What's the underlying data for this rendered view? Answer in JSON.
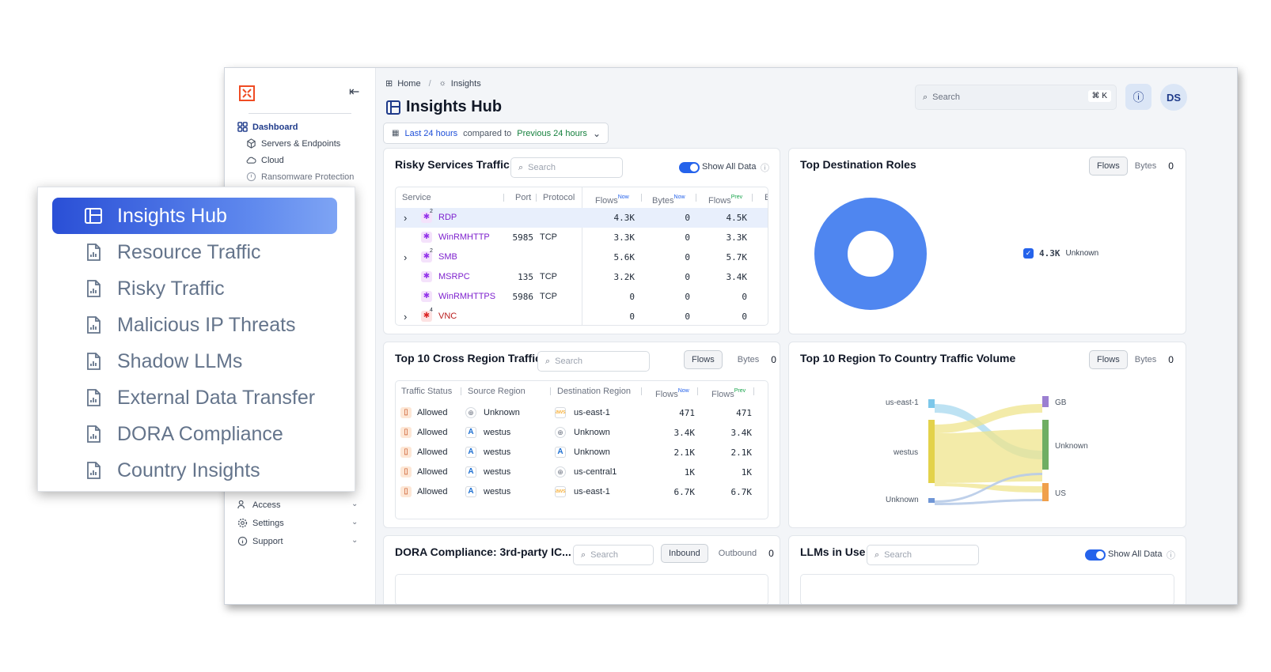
{
  "sidebar": {
    "dashboard": "Dashboard",
    "items": [
      "Servers & Endpoints",
      "Cloud",
      "Ransomware Protection"
    ],
    "bottom": [
      "Access",
      "Settings",
      "Support"
    ]
  },
  "popup": {
    "active": "Insights Hub",
    "items": [
      "Resource Traffic",
      "Risky Traffic",
      "Malicious IP Threats",
      "Shadow LLMs",
      "External Data Transfer",
      "DORA Compliance",
      "Country Insights"
    ]
  },
  "header": {
    "breadcrumb_home": "Home",
    "breadcrumb_sep": "/",
    "breadcrumb_current": "Insights",
    "title": "Insights Hub",
    "range_now": "Last 24 hours",
    "range_text": "compared to",
    "range_prev": "Previous 24 hours",
    "search_placeholder": "Search",
    "shortcut": "⌘ K",
    "avatar": "DS"
  },
  "risky": {
    "title": "Risky Services Traffic",
    "search": "Search",
    "toggle_label": "Show All Data",
    "cols": {
      "service": "Service",
      "port": "Port",
      "protocol": "Protocol",
      "flows": "Flows",
      "bytes": "Bytes",
      "flows2": "Flows",
      "b": "B",
      "now": "Now",
      "prev": "Prev"
    },
    "rows": [
      {
        "expand": true,
        "badge": "2",
        "name": "RDP",
        "port": "",
        "proto": "",
        "flows": "4.3K",
        "bytes": "0",
        "prev": "4.5K"
      },
      {
        "expand": false,
        "badge": "",
        "name": "WinRMHTTP",
        "port": "5985",
        "proto": "TCP",
        "flows": "3.3K",
        "bytes": "0",
        "prev": "3.3K"
      },
      {
        "expand": true,
        "badge": "2",
        "name": "SMB",
        "port": "",
        "proto": "",
        "flows": "5.6K",
        "bytes": "0",
        "prev": "5.7K"
      },
      {
        "expand": false,
        "badge": "",
        "name": "MSRPC",
        "port": "135",
        "proto": "TCP",
        "flows": "3.2K",
        "bytes": "0",
        "prev": "3.4K"
      },
      {
        "expand": false,
        "badge": "",
        "name": "WinRMHTTPS",
        "port": "5986",
        "proto": "TCP",
        "flows": "0",
        "bytes": "0",
        "prev": "0"
      },
      {
        "expand": true,
        "badge": "4",
        "name": "VNC",
        "port": "",
        "proto": "",
        "flows": "0",
        "bytes": "0",
        "prev": "0"
      }
    ]
  },
  "roles": {
    "title": "Top Destination Roles",
    "flows": "Flows",
    "bytes": "Bytes",
    "count": "0",
    "legend_value": "4.3K",
    "legend_label": "Unknown",
    "colors": {
      "donut": "#4f86f0"
    }
  },
  "cross": {
    "title": "Top 10 Cross Region Traffic",
    "search": "Search",
    "flows": "Flows",
    "bytes": "Bytes",
    "count": "0",
    "cols": {
      "status": "Traffic Status",
      "src": "Source Region",
      "dst": "Destination Region",
      "flows": "Flows",
      "flows2": "Flows",
      "now": "Now",
      "prev": "Prev"
    },
    "rows": [
      {
        "status": "Allowed",
        "src": "Unknown",
        "src_icon": "globe-icon",
        "dst": "us-east-1",
        "dst_icon": "aws-icon",
        "now": "471",
        "prev": "471"
      },
      {
        "status": "Allowed",
        "src": "westus",
        "src_icon": "azure-icon",
        "dst": "Unknown",
        "dst_icon": "globe-icon",
        "now": "3.4K",
        "prev": "3.4K"
      },
      {
        "status": "Allowed",
        "src": "westus",
        "src_icon": "azure-icon",
        "dst": "Unknown",
        "dst_icon": "azure-icon",
        "now": "2.1K",
        "prev": "2.1K"
      },
      {
        "status": "Allowed",
        "src": "westus",
        "src_icon": "azure-icon",
        "dst": "us-central1",
        "dst_icon": "globe-icon",
        "now": "1K",
        "prev": "1K"
      },
      {
        "status": "Allowed",
        "src": "westus",
        "src_icon": "azure-icon",
        "dst": "us-east-1",
        "dst_icon": "aws-icon",
        "now": "6.7K",
        "prev": "6.7K"
      }
    ]
  },
  "country": {
    "title": "Top 10 Region To Country Traffic Volume",
    "flows": "Flows",
    "bytes": "Bytes",
    "count": "0",
    "left": [
      "us-east-1",
      "westus",
      "Unknown"
    ],
    "right": [
      "GB",
      "Unknown",
      "US"
    ]
  },
  "dora": {
    "title": "DORA Compliance: 3rd-party IC...",
    "search": "Search",
    "inbound": "Inbound",
    "outbound": "Outbound",
    "count": "0"
  },
  "llm": {
    "title": "LLMs in Use",
    "search": "Search",
    "toggle_label": "Show All Data"
  }
}
